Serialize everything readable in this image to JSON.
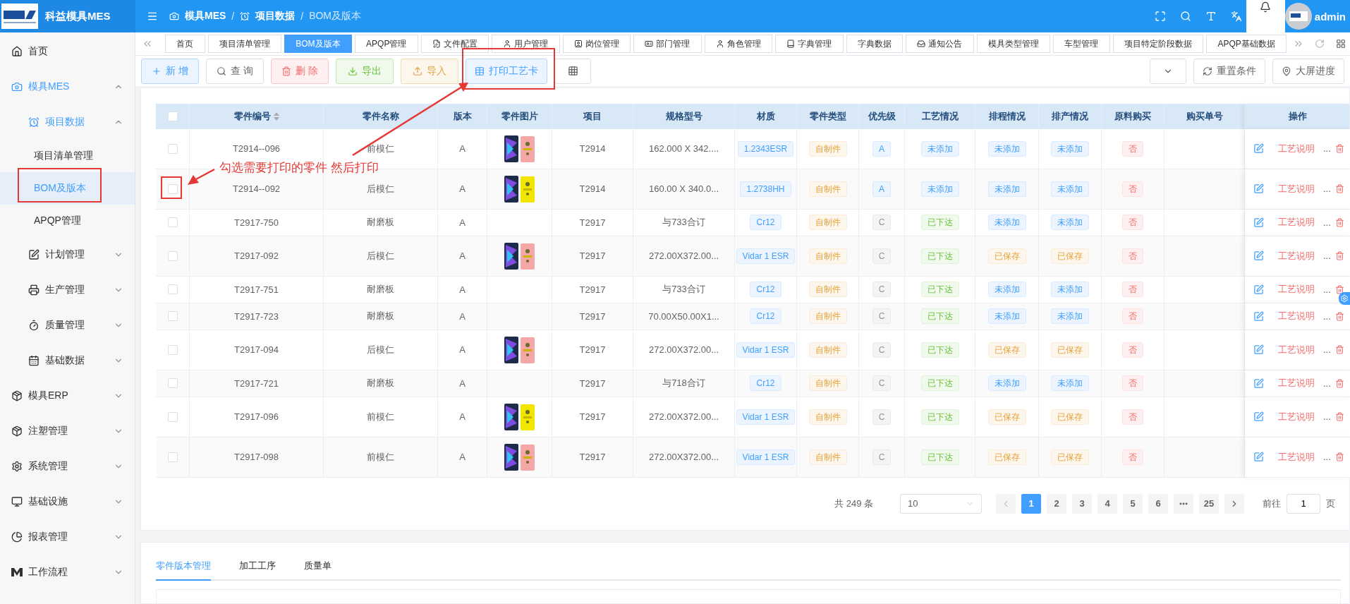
{
  "header": {
    "app_name": "科益模具MES",
    "breadcrumbs": [
      "模具MES",
      "项目数据",
      "BOM及版本"
    ],
    "separator": "/",
    "user": "admin"
  },
  "sidebar": {
    "items": [
      {
        "label": "首页"
      },
      {
        "label": "模具MES",
        "expanded": true,
        "children": [
          {
            "label": "项目数据",
            "expanded": true,
            "children": [
              {
                "label": "项目清单管理",
                "selected": false
              },
              {
                "label": "BOM及版本",
                "selected": true
              },
              {
                "label": "APQP管理",
                "selected": false
              }
            ]
          },
          {
            "label": "计划管理",
            "expanded": false
          },
          {
            "label": "生产管理",
            "expanded": false
          },
          {
            "label": "质量管理",
            "expanded": false
          },
          {
            "label": "基础数据",
            "expanded": false
          }
        ]
      },
      {
        "label": "模具ERP",
        "expanded": false
      },
      {
        "label": "注塑管理",
        "expanded": false
      },
      {
        "label": "系统管理",
        "expanded": false
      },
      {
        "label": "基础设施",
        "expanded": false
      },
      {
        "label": "报表管理",
        "expanded": false
      },
      {
        "label": "工作流程",
        "expanded": false
      }
    ]
  },
  "tabs": [
    {
      "label": "首页",
      "selected": false
    },
    {
      "label": "项目清单管理",
      "selected": false
    },
    {
      "label": "BOM及版本",
      "selected": true
    },
    {
      "label": "APQP管理",
      "selected": false
    },
    {
      "label": "文件配置",
      "selected": false
    },
    {
      "label": "用户管理",
      "selected": false
    },
    {
      "label": "岗位管理",
      "selected": false
    },
    {
      "label": "部门管理",
      "selected": false
    },
    {
      "label": "角色管理",
      "selected": false
    },
    {
      "label": "字典管理",
      "selected": false
    },
    {
      "label": "字典数据",
      "selected": false
    },
    {
      "label": "通知公告",
      "selected": false
    },
    {
      "label": "模具类型管理",
      "selected": false
    },
    {
      "label": "车型管理",
      "selected": false
    },
    {
      "label": "项目特定阶段数据",
      "selected": false
    },
    {
      "label": "APQP基础数据",
      "selected": false
    }
  ],
  "toolbar": {
    "buttons": [
      {
        "label": "新 增",
        "kind": "primary"
      },
      {
        "label": "查 询",
        "kind": "default"
      },
      {
        "label": "删 除",
        "kind": "danger"
      },
      {
        "label": "导出",
        "kind": "success"
      },
      {
        "label": "导入",
        "kind": "warning"
      },
      {
        "label": "打印工艺卡",
        "kind": "primary"
      }
    ],
    "right_buttons": [
      "重置条件",
      "大屏进度"
    ]
  },
  "table": {
    "all_checked": false,
    "columns": [
      {
        "label": "零件编号",
        "sortable": true
      },
      {
        "label": "零件名称",
        "sortable": false
      },
      {
        "label": "版本",
        "sortable": false
      },
      {
        "label": "零件图片",
        "sortable": false
      },
      {
        "label": "项目",
        "sortable": false
      },
      {
        "label": "规格型号",
        "sortable": false
      },
      {
        "label": "材质",
        "sortable": false
      },
      {
        "label": "零件类型",
        "sortable": false
      },
      {
        "label": "优先级",
        "sortable": false
      },
      {
        "label": "工艺情况",
        "sortable": false
      },
      {
        "label": "排程情况",
        "sortable": false
      },
      {
        "label": "排产情况",
        "sortable": false
      },
      {
        "label": "原料购买",
        "sortable": false
      },
      {
        "label": "购买单号",
        "sortable": false
      },
      {
        "label": "操作",
        "sortable": false
      }
    ],
    "rows": [
      {
        "checked": false,
        "code": "T2914--096",
        "name": "前模仁",
        "version": "A",
        "image": {
          "kind": "picture"
        },
        "project": "T2914",
        "spec": "162.000 X 342....",
        "tags": [
          {
            "text": "1.2343ESR",
            "kind": "primary"
          },
          {
            "text": "自制件",
            "kind": "warning"
          },
          {
            "text": "A",
            "kind": "primary"
          },
          {
            "text": "未添加",
            "kind": "primary"
          },
          {
            "text": "未添加",
            "kind": "primary"
          },
          {
            "text": "未添加",
            "kind": "primary"
          },
          {
            "text": "否",
            "kind": "danger"
          }
        ],
        "link": "工艺说明",
        "more": "..."
      },
      {
        "checked": false,
        "code": "T2914--092",
        "name": "后模仁",
        "version": "A",
        "image": {
          "kind": "picture"
        },
        "project": "T2914",
        "spec": "160.00 X 340.0...",
        "tags": [
          {
            "text": "1.2738HH",
            "kind": "primary"
          },
          {
            "text": "自制件",
            "kind": "warning"
          },
          {
            "text": "A",
            "kind": "primary"
          },
          {
            "text": "未添加",
            "kind": "primary"
          },
          {
            "text": "未添加",
            "kind": "primary"
          },
          {
            "text": "未添加",
            "kind": "primary"
          },
          {
            "text": "否",
            "kind": "danger"
          }
        ],
        "link": "工艺说明",
        "more": "..."
      },
      {
        "checked": false,
        "code": "T2917-750",
        "name": "耐磨板",
        "version": "A",
        "project": "T2917",
        "spec": "与733合订",
        "tags": [
          {
            "text": "Cr12",
            "kind": "primary"
          },
          {
            "text": "自制件",
            "kind": "warning"
          },
          {
            "text": "C",
            "kind": "info"
          },
          {
            "text": "已下达",
            "kind": "success"
          },
          {
            "text": "未添加",
            "kind": "primary"
          },
          {
            "text": "未添加",
            "kind": "primary"
          },
          {
            "text": "否",
            "kind": "danger"
          }
        ],
        "link": "工艺说明",
        "more": "..."
      },
      {
        "checked": false,
        "code": "T2917-092",
        "name": "后模仁",
        "version": "A",
        "image": {
          "kind": "picture"
        },
        "project": "T2917",
        "spec": "272.00X372.00...",
        "tags": [
          {
            "text": "Vidar 1 ESR",
            "kind": "primary"
          },
          {
            "text": "自制件",
            "kind": "warning"
          },
          {
            "text": "C",
            "kind": "info"
          },
          {
            "text": "已下达",
            "kind": "success"
          },
          {
            "text": "已保存",
            "kind": "warning"
          },
          {
            "text": "已保存",
            "kind": "warning"
          },
          {
            "text": "否",
            "kind": "danger"
          }
        ],
        "link": "工艺说明",
        "more": "..."
      },
      {
        "checked": false,
        "code": "T2917-751",
        "name": "耐磨板",
        "version": "A",
        "project": "T2917",
        "spec": "与733合订",
        "tags": [
          {
            "text": "Cr12",
            "kind": "primary"
          },
          {
            "text": "自制件",
            "kind": "warning"
          },
          {
            "text": "C",
            "kind": "info"
          },
          {
            "text": "已下达",
            "kind": "success"
          },
          {
            "text": "未添加",
            "kind": "primary"
          },
          {
            "text": "未添加",
            "kind": "primary"
          },
          {
            "text": "否",
            "kind": "danger"
          }
        ],
        "link": "工艺说明",
        "more": "..."
      },
      {
        "checked": false,
        "code": "T2917-723",
        "name": "耐磨板",
        "version": "A",
        "project": "T2917",
        "spec": "70.00X50.00X1...",
        "tags": [
          {
            "text": "Cr12",
            "kind": "primary"
          },
          {
            "text": "自制件",
            "kind": "warning"
          },
          {
            "text": "C",
            "kind": "info"
          },
          {
            "text": "已下达",
            "kind": "success"
          },
          {
            "text": "未添加",
            "kind": "primary"
          },
          {
            "text": "未添加",
            "kind": "primary"
          },
          {
            "text": "否",
            "kind": "danger"
          }
        ],
        "link": "工艺说明",
        "more": "..."
      },
      {
        "checked": false,
        "code": "T2917-094",
        "name": "后模仁",
        "version": "A",
        "image": {
          "kind": "picture"
        },
        "project": "T2917",
        "spec": "272.00X372.00...",
        "tags": [
          {
            "text": "Vidar 1 ESR",
            "kind": "primary"
          },
          {
            "text": "自制件",
            "kind": "warning"
          },
          {
            "text": "C",
            "kind": "info"
          },
          {
            "text": "已下达",
            "kind": "success"
          },
          {
            "text": "已保存",
            "kind": "warning"
          },
          {
            "text": "已保存",
            "kind": "warning"
          },
          {
            "text": "否",
            "kind": "danger"
          }
        ],
        "link": "工艺说明",
        "more": "..."
      },
      {
        "checked": false,
        "code": "T2917-721",
        "name": "耐磨板",
        "version": "A",
        "project": "T2917",
        "spec": "与718合订",
        "tags": [
          {
            "text": "Cr12",
            "kind": "primary"
          },
          {
            "text": "自制件",
            "kind": "warning"
          },
          {
            "text": "C",
            "kind": "info"
          },
          {
            "text": "已下达",
            "kind": "success"
          },
          {
            "text": "未添加",
            "kind": "primary"
          },
          {
            "text": "未添加",
            "kind": "primary"
          },
          {
            "text": "否",
            "kind": "danger"
          }
        ],
        "link": "工艺说明",
        "more": "..."
      },
      {
        "checked": false,
        "code": "T2917-096",
        "name": "前模仁",
        "version": "A",
        "image": {
          "kind": "picture"
        },
        "project": "T2917",
        "spec": "272.00X372.00...",
        "tags": [
          {
            "text": "Vidar 1 ESR",
            "kind": "primary"
          },
          {
            "text": "自制件",
            "kind": "warning"
          },
          {
            "text": "C",
            "kind": "info"
          },
          {
            "text": "已下达",
            "kind": "success"
          },
          {
            "text": "已保存",
            "kind": "warning"
          },
          {
            "text": "已保存",
            "kind": "warning"
          },
          {
            "text": "否",
            "kind": "danger"
          }
        ],
        "link": "工艺说明",
        "more": "..."
      },
      {
        "checked": false,
        "code": "T2917-098",
        "name": "前模仁",
        "version": "A",
        "image": {
          "kind": "picture"
        },
        "project": "T2917",
        "spec": "272.00X372.00...",
        "tags": [
          {
            "text": "Vidar 1 ESR",
            "kind": "primary"
          },
          {
            "text": "自制件",
            "kind": "warning"
          },
          {
            "text": "C",
            "kind": "info"
          },
          {
            "text": "已下达",
            "kind": "success"
          },
          {
            "text": "已保存",
            "kind": "warning"
          },
          {
            "text": "已保存",
            "kind": "warning"
          },
          {
            "text": "否",
            "kind": "danger"
          }
        ],
        "link": "工艺说明",
        "more": "..."
      }
    ]
  },
  "pagination": {
    "total": "共 249 条",
    "page_size": "10",
    "pages": [
      {
        "label": "1",
        "selected": true
      },
      {
        "label": "2",
        "selected": false
      },
      {
        "label": "3",
        "selected": false
      },
      {
        "label": "4",
        "selected": false
      },
      {
        "label": "5",
        "selected": false
      },
      {
        "label": "6",
        "selected": false
      },
      {
        "label": "25",
        "selected": false
      }
    ],
    "goto_label": "前往",
    "goto_value": "1",
    "goto_suffix": "页"
  },
  "bottom_tabs": [
    {
      "label": "零件版本管理",
      "selected": true
    },
    {
      "label": "加工工序",
      "selected": false
    },
    {
      "label": "质量单",
      "selected": false
    }
  ],
  "annotation": {
    "text": "勾选需要打印的零件 然后打印"
  }
}
